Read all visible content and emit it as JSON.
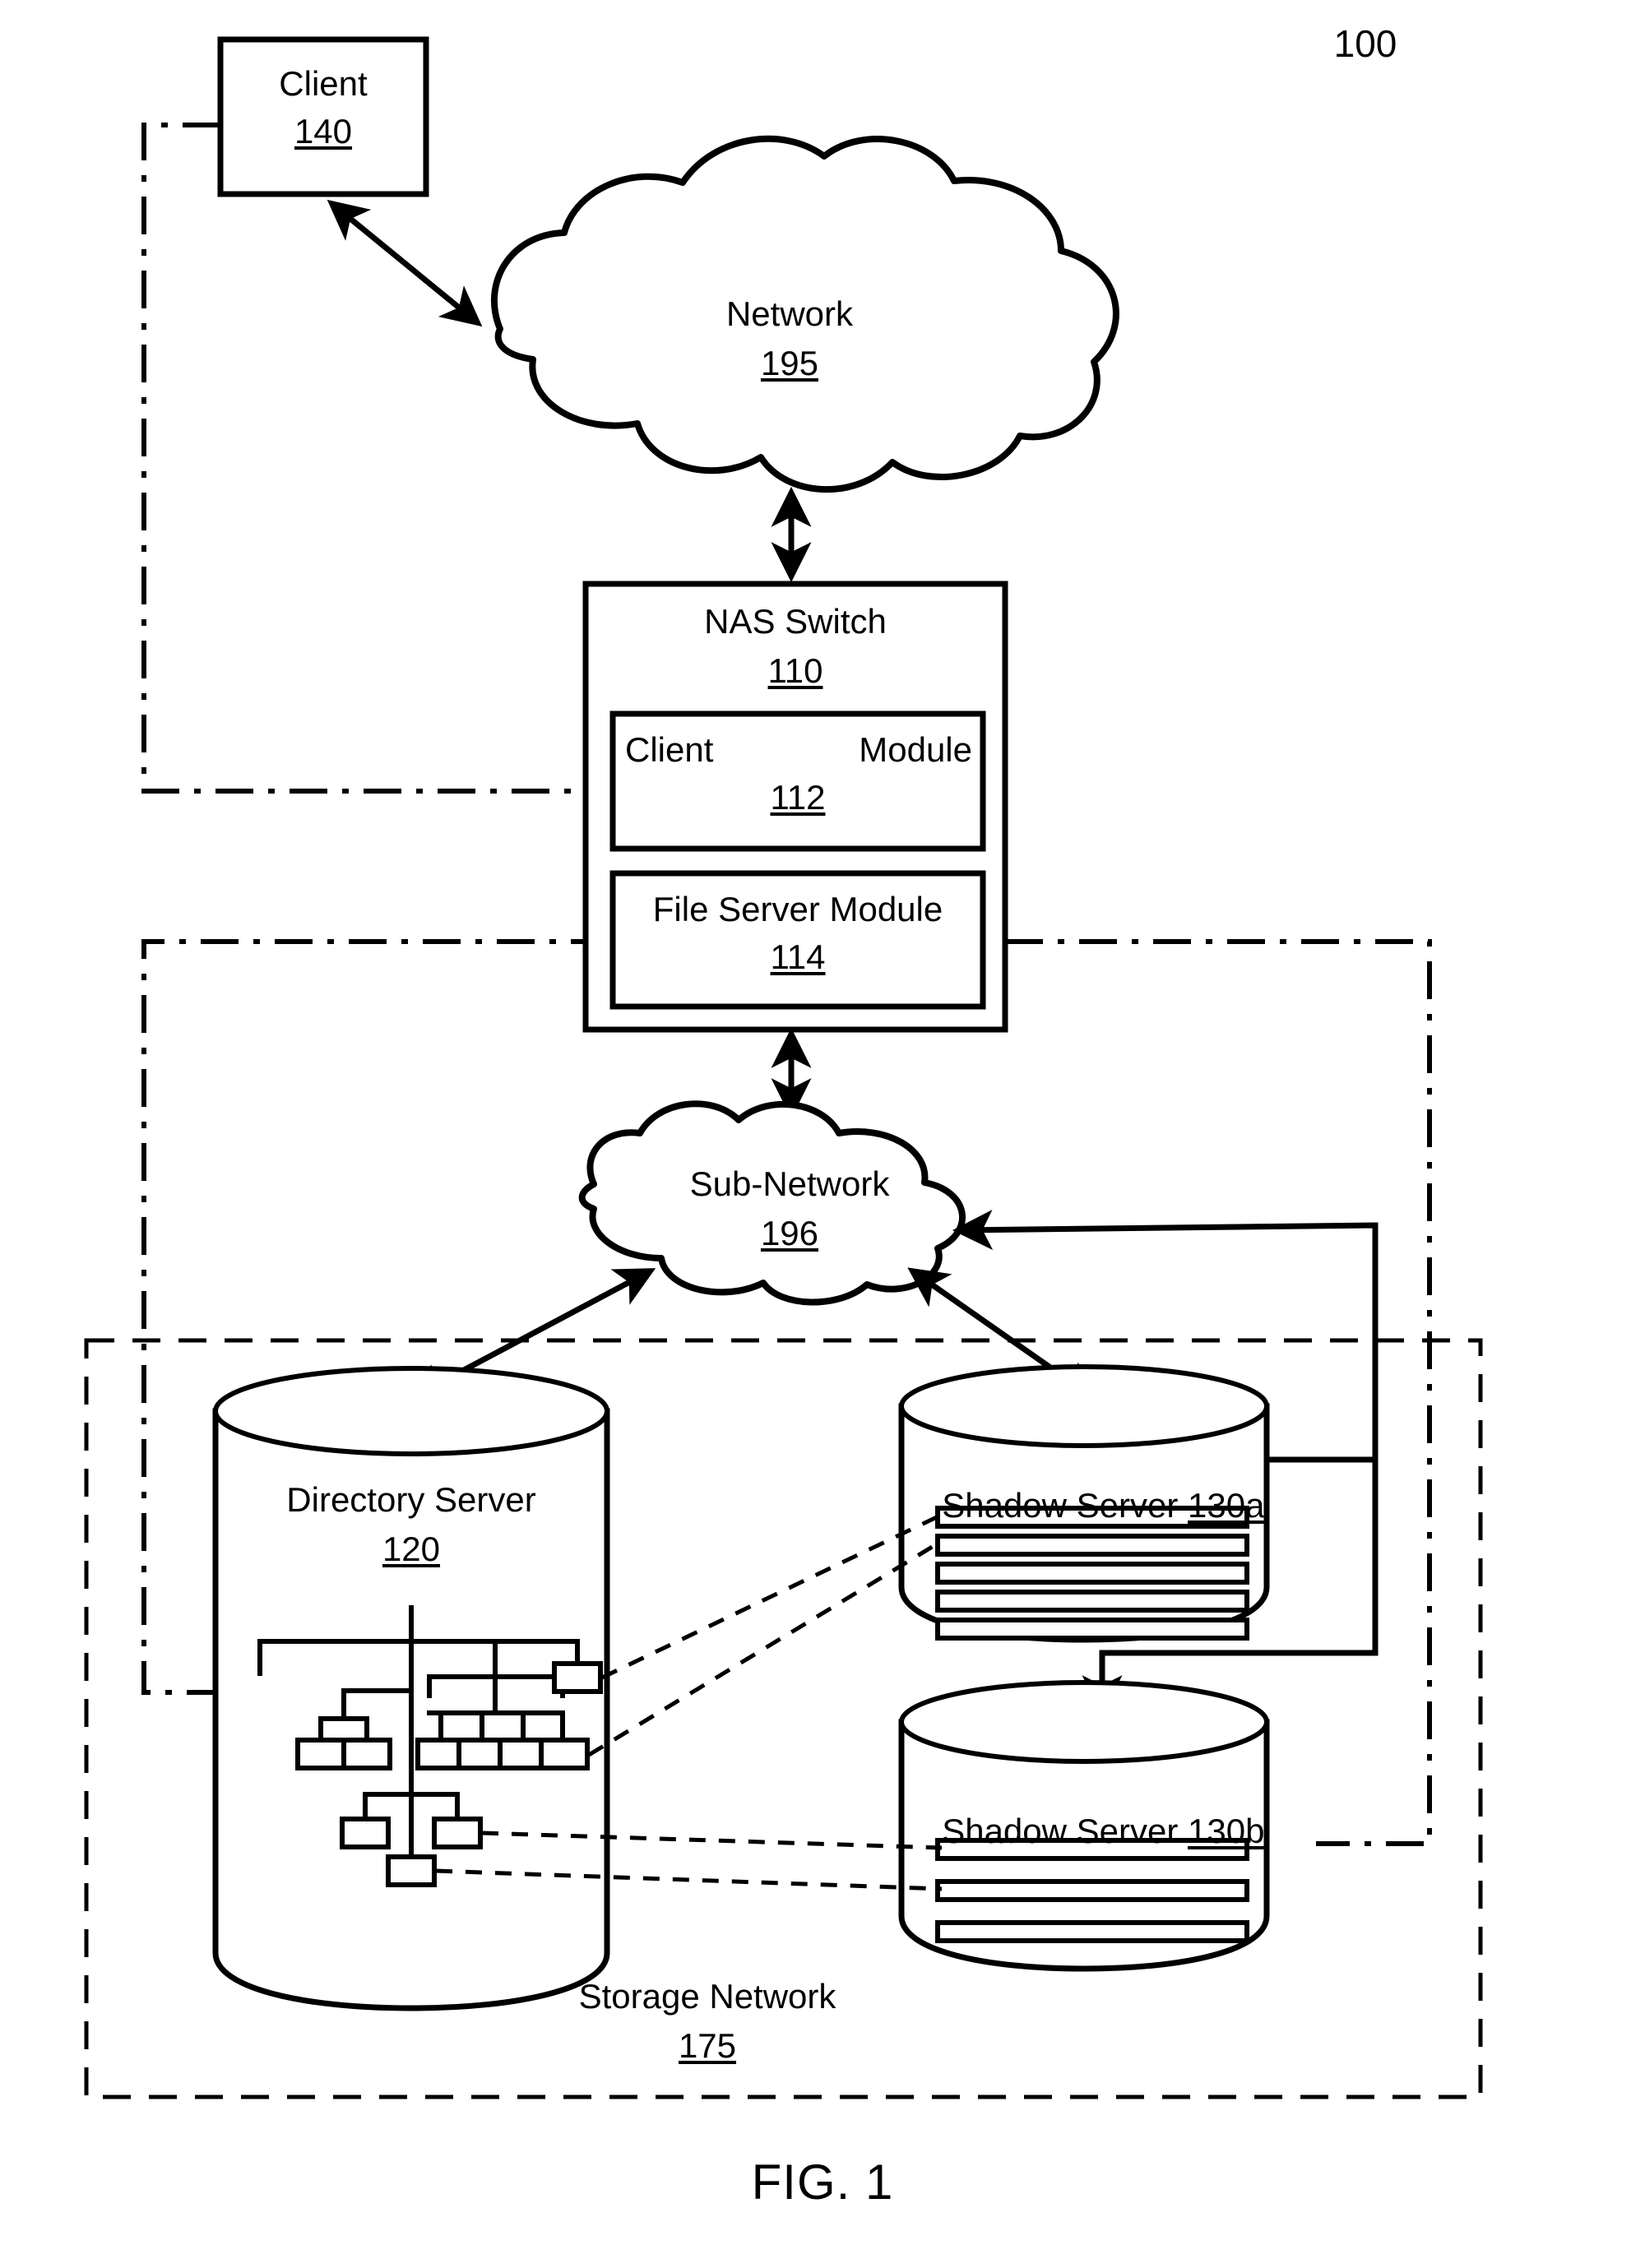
{
  "figure": {
    "caption": "FIG. 1",
    "reference_numeral": "100"
  },
  "nodes": {
    "client": {
      "title": "Client",
      "numeral": "140"
    },
    "network": {
      "title": "Network",
      "numeral": "195"
    },
    "nas_switch": {
      "title": "NAS Switch",
      "numeral": "110"
    },
    "client_module": {
      "title_left": "Client",
      "title_right": "Module",
      "numeral": "112"
    },
    "file_server_module": {
      "title": "File Server Module",
      "numeral": "114"
    },
    "sub_network": {
      "title": "Sub-Network",
      "numeral": "196"
    },
    "directory_server": {
      "title": "Directory Server",
      "numeral": "120"
    },
    "shadow_server_a": {
      "title": "Shadow Server 130a",
      "bar_count": 5
    },
    "shadow_server_b": {
      "title": "Shadow Server 130b",
      "bar_count": 3
    },
    "storage_network": {
      "title": "Storage Network",
      "numeral": "175"
    }
  },
  "colors": {
    "stroke": "#000000",
    "background": "#ffffff"
  }
}
